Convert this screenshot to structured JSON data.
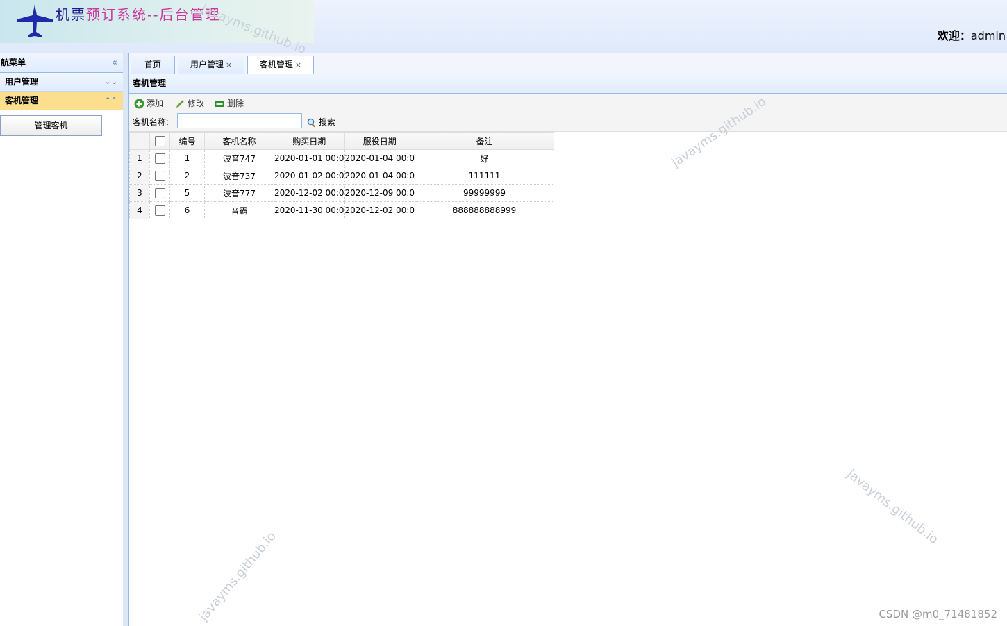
{
  "header": {
    "title_part1": "机票",
    "title_part2": "预订系统--后台管理",
    "welcome_label": "欢迎：",
    "username": "admin"
  },
  "sidebar": {
    "title": "航菜单",
    "collapse_icon": "double-chevron-left-icon",
    "groups": [
      {
        "label": "用户管理",
        "expanded": false
      },
      {
        "label": "客机管理",
        "expanded": true
      }
    ],
    "items": [
      {
        "label": "管理客机"
      }
    ]
  },
  "tabs": [
    {
      "label": "首页",
      "closable": false
    },
    {
      "label": "用户管理",
      "closable": true
    },
    {
      "label": "客机管理",
      "closable": true,
      "active": true
    }
  ],
  "panel": {
    "title": "客机管理",
    "toolbar": {
      "add": "添加",
      "edit": "修改",
      "delete": "删除"
    },
    "search": {
      "label": "客机名称:",
      "value": "",
      "button": "搜索"
    }
  },
  "grid": {
    "columns": [
      "编号",
      "客机名称",
      "购买日期",
      "服役日期",
      "备注"
    ],
    "rows": [
      {
        "rownum": "1",
        "id": "1",
        "name": "波音747",
        "buy": "2020-01-01 00:0",
        "service": "2020-01-04 00:0",
        "note": "好"
      },
      {
        "rownum": "2",
        "id": "2",
        "name": "波音737",
        "buy": "2020-01-02 00:0",
        "service": "2020-01-04 00:0",
        "note": "111111"
      },
      {
        "rownum": "3",
        "id": "5",
        "name": "波音777",
        "buy": "2020-12-02 00:0",
        "service": "2020-12-09 00:0",
        "note": "99999999"
      },
      {
        "rownum": "4",
        "id": "6",
        "name": "音霸",
        "buy": "2020-11-30 00:0",
        "service": "2020-12-02 00:0",
        "note": "888888888999"
      }
    ]
  },
  "watermarks": [
    "javayms.github.io",
    "javayms.github.io",
    "javayms.github.io",
    "javayms.github.io"
  ],
  "footer": {
    "credit": "CSDN @m0_71481852"
  }
}
